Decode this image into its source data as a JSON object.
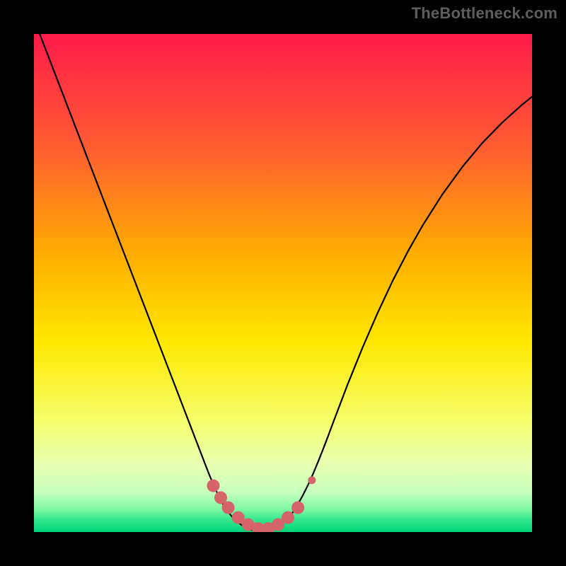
{
  "watermark": "TheBottleneck.com",
  "chart_data": {
    "type": "line",
    "title": "",
    "xlabel": "",
    "ylabel": "",
    "xlim": [
      0,
      100
    ],
    "ylim": [
      0,
      100
    ],
    "grid": false,
    "legend": false,
    "background_gradient": {
      "direction": "vertical",
      "stops": [
        {
          "offset": 0.0,
          "color": "#ff1a4a"
        },
        {
          "offset": 0.22,
          "color": "#ff5a33"
        },
        {
          "offset": 0.45,
          "color": "#ffb000"
        },
        {
          "offset": 0.62,
          "color": "#ffe800"
        },
        {
          "offset": 0.78,
          "color": "#f5ff6e"
        },
        {
          "offset": 0.86,
          "color": "#e9ffae"
        },
        {
          "offset": 0.92,
          "color": "#c7ffbf"
        },
        {
          "offset": 0.955,
          "color": "#7cf8a1"
        },
        {
          "offset": 0.975,
          "color": "#33e98e"
        },
        {
          "offset": 1.0,
          "color": "#00d37a"
        }
      ]
    },
    "series": [
      {
        "name": "bottleneck-curve",
        "stroke": "#000000",
        "stroke_width": 2.2,
        "x": [
          0,
          1,
          2,
          3,
          4,
          5,
          6,
          7,
          8,
          9,
          10,
          11,
          12,
          13,
          14,
          15,
          16,
          17,
          18,
          19,
          20,
          21,
          22,
          23,
          24,
          25,
          26,
          27,
          28,
          29,
          30,
          31,
          32,
          33,
          34,
          35,
          36,
          37,
          38,
          39,
          40,
          41,
          42,
          43,
          44,
          45,
          46,
          47,
          48,
          49,
          50,
          51,
          52,
          53,
          54,
          55,
          56,
          57,
          58,
          59,
          60,
          63,
          66,
          69,
          72,
          75,
          78,
          82,
          86,
          90,
          94,
          98,
          100
        ],
        "y": [
          103,
          100.4,
          97.8,
          95.2,
          92.6,
          90,
          87.4,
          84.8,
          82.2,
          79.6,
          77,
          74.4,
          71.8,
          69.2,
          66.6,
          64,
          61.4,
          58.8,
          56.2,
          53.6,
          51,
          48.4,
          45.8,
          43.2,
          40.6,
          38,
          35.4,
          32.8,
          30.2,
          27.6,
          25,
          22.4,
          19.8,
          17.2,
          14.6,
          12,
          9.6,
          7.4,
          5.5,
          4,
          2.8,
          1.9,
          1.2,
          0.7,
          0.35,
          0.15,
          0.15,
          0.35,
          0.7,
          1.2,
          1.9,
          2.8,
          4,
          5.6,
          7.4,
          9.4,
          11.6,
          14,
          16.5,
          19.1,
          21.8,
          29.7,
          37.1,
          44,
          50.4,
          56.2,
          61.5,
          67.8,
          73.3,
          78.1,
          82.2,
          85.8,
          87.4
        ]
      },
      {
        "name": "bottom-markers",
        "type": "scatter",
        "color": "#d4636a",
        "radius": 9,
        "x": [
          36,
          37.5,
          39,
          41,
          43,
          45,
          47,
          49,
          51,
          53
        ],
        "y": [
          9.3,
          6.9,
          4.9,
          2.9,
          1.5,
          0.7,
          0.7,
          1.5,
          2.9,
          4.9
        ]
      },
      {
        "name": "outlier-marker",
        "type": "scatter",
        "color": "#d4636a",
        "radius": 5.5,
        "x": [
          55.8
        ],
        "y": [
          10.4
        ]
      }
    ]
  }
}
